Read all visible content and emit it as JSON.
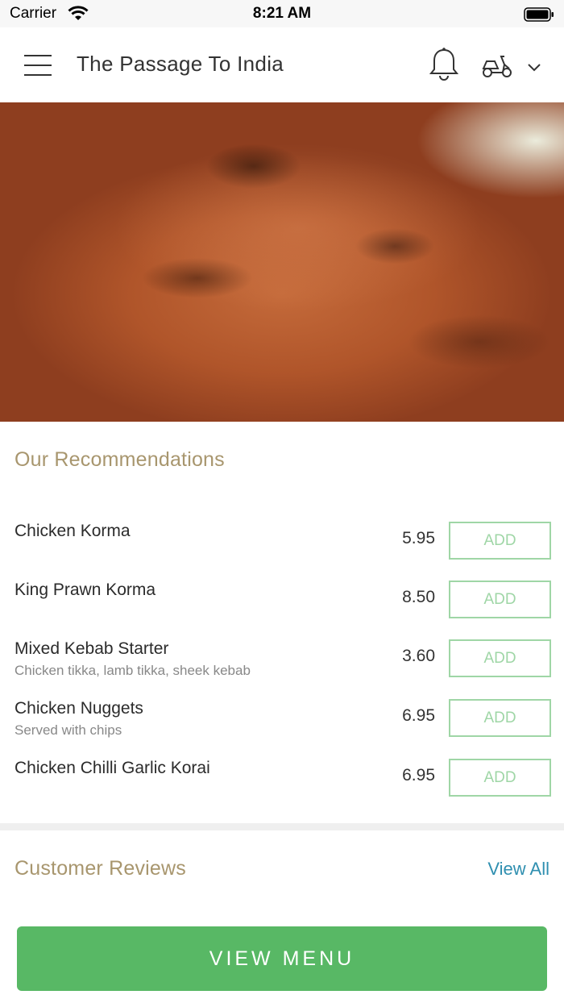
{
  "status_bar": {
    "carrier": "Carrier",
    "time": "8:21 AM"
  },
  "header": {
    "title": "The Passage To India",
    "icons": [
      "menu-icon",
      "bell-icon",
      "scooter-icon",
      "chevron-down-icon"
    ]
  },
  "recommendations": {
    "title": "Our Recommendations",
    "add_label": "ADD",
    "items": [
      {
        "name": "Chicken Korma",
        "description": "",
        "price": "5.95"
      },
      {
        "name": "King Prawn Korma",
        "description": "",
        "price": "8.50"
      },
      {
        "name": "Mixed Kebab Starter",
        "description": "Chicken tikka, lamb tikka, sheek kebab",
        "price": "3.60"
      },
      {
        "name": "Chicken Nuggets",
        "description": "Served with chips",
        "price": "6.95"
      },
      {
        "name": "Chicken Chilli Garlic Korai",
        "description": "",
        "price": "6.95"
      }
    ]
  },
  "reviews": {
    "title": "Customer Reviews",
    "view_all_label": "View All"
  },
  "footer": {
    "view_menu_label": "VIEW MENU"
  },
  "colors": {
    "accent_green": "#58b865",
    "add_border": "#9fd6a6",
    "section_title": "#a8966e",
    "link_blue": "#2f8fb0"
  }
}
